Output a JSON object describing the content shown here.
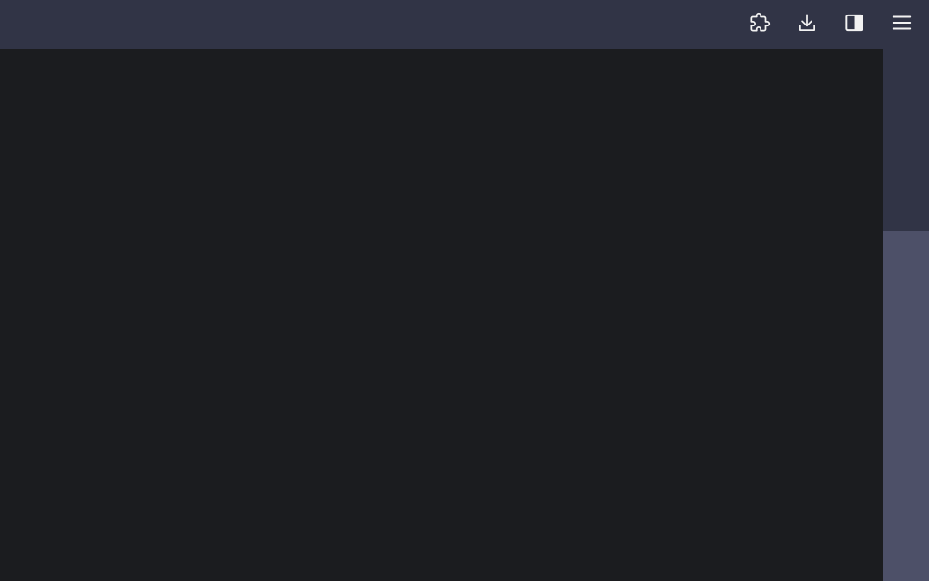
{
  "toolbar": {
    "buttons": [
      {
        "icon": "extensions-puzzle-icon"
      },
      {
        "icon": "downloads-icon"
      },
      {
        "icon": "sidebar-toggle-icon"
      },
      {
        "icon": "menu-hamburger-icon"
      }
    ]
  },
  "colors": {
    "toolbar_bg": "#313446",
    "content_bg": "#1b1c1f",
    "scrollbar_track": "#313446",
    "scrollbar_thumb": "#4d5068",
    "icon_color": "#f2f2f2"
  }
}
